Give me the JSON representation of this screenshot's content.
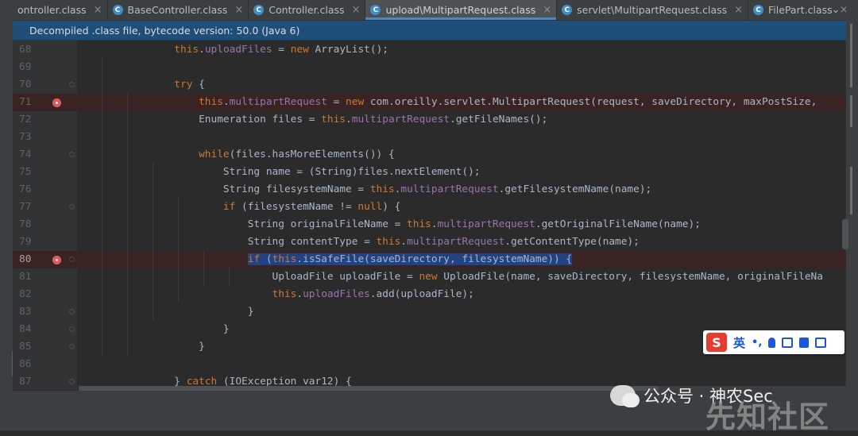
{
  "tabs": [
    {
      "label": "ontroller.class",
      "active": false,
      "icon": ""
    },
    {
      "label": "BaseController.class",
      "active": false,
      "icon": "C"
    },
    {
      "label": "Controller.class",
      "active": false,
      "icon": "C"
    },
    {
      "label": "upload\\MultipartRequest.class",
      "active": true,
      "icon": "C"
    },
    {
      "label": "servlet\\MultipartRequest.class",
      "active": false,
      "icon": "C"
    },
    {
      "label": "FilePart.class",
      "active": false,
      "icon": "C"
    }
  ],
  "tab_close_glyph": "×",
  "tabs_more_glyph": "⌄",
  "banner": {
    "text": "Decompiled .class file, bytecode version: 50.0 (Java 6)"
  },
  "lines": [
    {
      "num": "68",
      "tokens": [
        {
          "t": "                ",
          "c": ""
        },
        {
          "t": "this",
          "c": "k"
        },
        {
          "t": ".",
          "c": ""
        },
        {
          "t": "uploadFiles",
          "c": "f"
        },
        {
          "t": " = ",
          "c": ""
        },
        {
          "t": "new",
          "c": "k"
        },
        {
          "t": " ArrayList();",
          "c": ""
        }
      ]
    },
    {
      "num": "69",
      "tokens": []
    },
    {
      "num": "70",
      "fold": true,
      "tokens": [
        {
          "t": "                ",
          "c": ""
        },
        {
          "t": "try",
          "c": "k"
        },
        {
          "t": " {",
          "c": ""
        }
      ]
    },
    {
      "num": "71",
      "bp": true,
      "tokens": [
        {
          "t": "                    ",
          "c": ""
        },
        {
          "t": "this",
          "c": "k"
        },
        {
          "t": ".",
          "c": ""
        },
        {
          "t": "multipartRequest",
          "c": "f"
        },
        {
          "t": " = ",
          "c": ""
        },
        {
          "t": "new",
          "c": "k"
        },
        {
          "t": " com.oreilly.servlet.MultipartRequest(request, saveDirectory, maxPostSize, ",
          "c": ""
        }
      ]
    },
    {
      "num": "72",
      "tokens": [
        {
          "t": "                    Enumeration files = ",
          "c": ""
        },
        {
          "t": "this",
          "c": "k"
        },
        {
          "t": ".",
          "c": ""
        },
        {
          "t": "multipartRequest",
          "c": "f"
        },
        {
          "t": ".getFileNames();",
          "c": ""
        }
      ]
    },
    {
      "num": "73",
      "tokens": []
    },
    {
      "num": "74",
      "fold": true,
      "tokens": [
        {
          "t": "                    ",
          "c": ""
        },
        {
          "t": "while",
          "c": "k"
        },
        {
          "t": "(files.hasMoreElements()) {",
          "c": ""
        }
      ]
    },
    {
      "num": "75",
      "tokens": [
        {
          "t": "                        String name = (String)files.nextElement();",
          "c": ""
        }
      ]
    },
    {
      "num": "76",
      "tokens": [
        {
          "t": "                        String filesystemName = ",
          "c": ""
        },
        {
          "t": "this",
          "c": "k"
        },
        {
          "t": ".",
          "c": ""
        },
        {
          "t": "multipartRequest",
          "c": "f"
        },
        {
          "t": ".getFilesystemName(name);",
          "c": ""
        }
      ]
    },
    {
      "num": "77",
      "fold": true,
      "tokens": [
        {
          "t": "                        ",
          "c": ""
        },
        {
          "t": "if",
          "c": "k"
        },
        {
          "t": " (filesystemName != ",
          "c": ""
        },
        {
          "t": "null",
          "c": "k"
        },
        {
          "t": ") {",
          "c": ""
        }
      ]
    },
    {
      "num": "78",
      "tokens": [
        {
          "t": "                            String originalFileName = ",
          "c": ""
        },
        {
          "t": "this",
          "c": "k"
        },
        {
          "t": ".",
          "c": ""
        },
        {
          "t": "multipartRequest",
          "c": "f"
        },
        {
          "t": ".getOriginalFileName(name);",
          "c": ""
        }
      ]
    },
    {
      "num": "79",
      "tokens": [
        {
          "t": "                            String contentType = ",
          "c": ""
        },
        {
          "t": "this",
          "c": "k"
        },
        {
          "t": ".",
          "c": ""
        },
        {
          "t": "multipartRequest",
          "c": "f"
        },
        {
          "t": ".getContentType(name);",
          "c": ""
        }
      ]
    },
    {
      "num": "80",
      "bp": true,
      "current": true,
      "fold": true,
      "tokens": [
        {
          "t": "                            ",
          "c": ""
        },
        {
          "t": "if",
          "c": "k hl"
        },
        {
          "t": " (",
          "c": "hl"
        },
        {
          "t": "this",
          "c": "k hl"
        },
        {
          "t": ".isSafeFile(saveDirectory, filesystemName)) {",
          "c": "hl"
        }
      ]
    },
    {
      "num": "81",
      "tokens": [
        {
          "t": "                                UploadFile uploadFile = ",
          "c": ""
        },
        {
          "t": "new",
          "c": "k"
        },
        {
          "t": " UploadFile(name, saveDirectory, filesystemName, originalFileNa",
          "c": ""
        }
      ]
    },
    {
      "num": "82",
      "tokens": [
        {
          "t": "                                ",
          "c": ""
        },
        {
          "t": "this",
          "c": "k"
        },
        {
          "t": ".",
          "c": ""
        },
        {
          "t": "uploadFiles",
          "c": "f"
        },
        {
          "t": ".add(uploadFile);",
          "c": ""
        }
      ]
    },
    {
      "num": "83",
      "fold": true,
      "tokens": [
        {
          "t": "                            }",
          "c": ""
        }
      ]
    },
    {
      "num": "84",
      "fold": true,
      "tokens": [
        {
          "t": "                        }",
          "c": ""
        }
      ]
    },
    {
      "num": "85",
      "fold": true,
      "tokens": [
        {
          "t": "                    }",
          "c": ""
        }
      ]
    },
    {
      "num": "86",
      "tokens": []
    },
    {
      "num": "87",
      "fold": true,
      "tokens": [
        {
          "t": "                } ",
          "c": ""
        },
        {
          "t": "catch",
          "c": "k"
        },
        {
          "t": " (IOException var12) {",
          "c": ""
        }
      ]
    }
  ],
  "ime": {
    "logo": "S",
    "lang": "英",
    "punct": "•,",
    "icons": [
      "microphone-icon",
      "keyboard-icon",
      "skin-icon",
      "toolbox-icon"
    ]
  },
  "watermark": {
    "text": "公众号 · 神农Sec",
    "site": "先知社区"
  },
  "colors": {
    "keyword": "#cc7832",
    "field": "#9876aa",
    "text": "#a9b7c6",
    "selection": "#214283",
    "breakpoint": "#db5c5c",
    "banner": "#1f4e79"
  }
}
